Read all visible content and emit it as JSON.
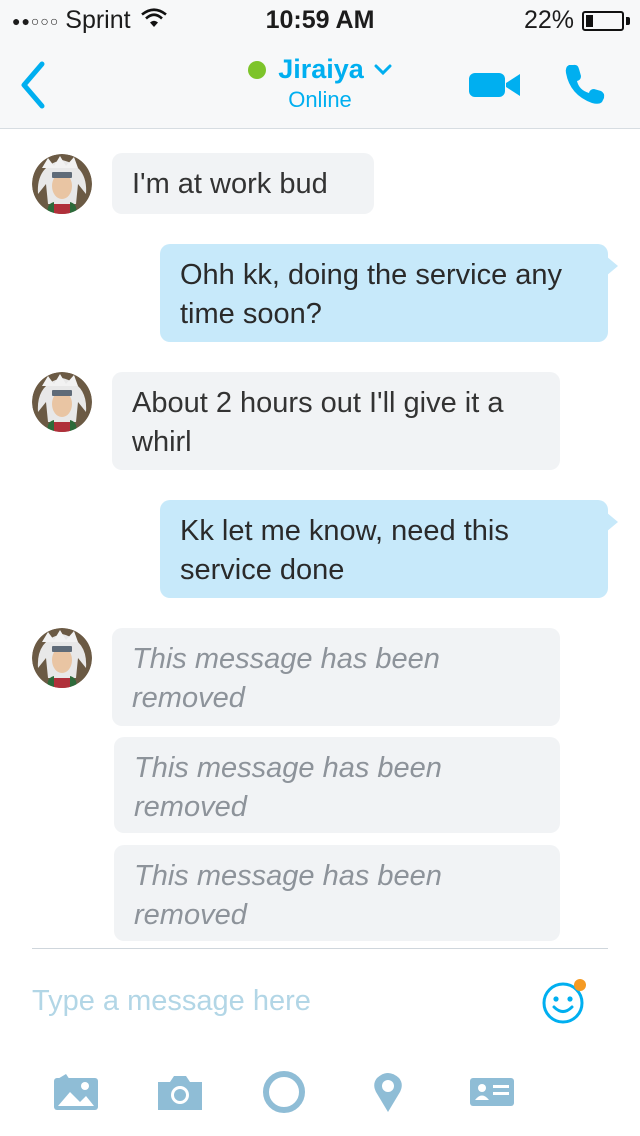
{
  "status_bar": {
    "signal": "●●○○○",
    "carrier": "Sprint",
    "time": "10:59 AM",
    "battery_percent": "22%",
    "battery_level": 0.22
  },
  "header": {
    "contact_name": "Jiraiya",
    "contact_status": "Online",
    "presence_color": "#7dc42a",
    "accent_color": "#00aff0",
    "icons": [
      "back-chevron-icon",
      "chevron-down-icon",
      "video-call-icon",
      "phone-icon"
    ]
  },
  "messages": [
    {
      "direction": "incoming",
      "text": "I'm at work bud"
    },
    {
      "direction": "outgoing",
      "text": "Ohh kk, doing the service any time soon?"
    },
    {
      "direction": "incoming",
      "text": "About 2 hours out I'll give it a whirl"
    },
    {
      "direction": "outgoing",
      "text": "Kk let me know, need this service done"
    },
    {
      "direction": "incoming",
      "text": "This message has been removed",
      "removed": true
    },
    {
      "direction": "incoming",
      "text": "This message has been removed",
      "removed": true
    },
    {
      "direction": "incoming",
      "text": "This message has been removed",
      "removed": true
    }
  ],
  "composer": {
    "placeholder": "Type a message here",
    "emoji_icon": "smiley-icon"
  },
  "toolbar": {
    "icons": [
      "media-icon",
      "camera-icon",
      "video-message-icon",
      "location-icon",
      "contact-card-icon"
    ]
  },
  "colors": {
    "incoming_bubble": "#f1f3f5",
    "outgoing_bubble": "#c7e9fa",
    "toolbar_icon": "#8fbdd6",
    "notification_dot": "#f59a23"
  }
}
